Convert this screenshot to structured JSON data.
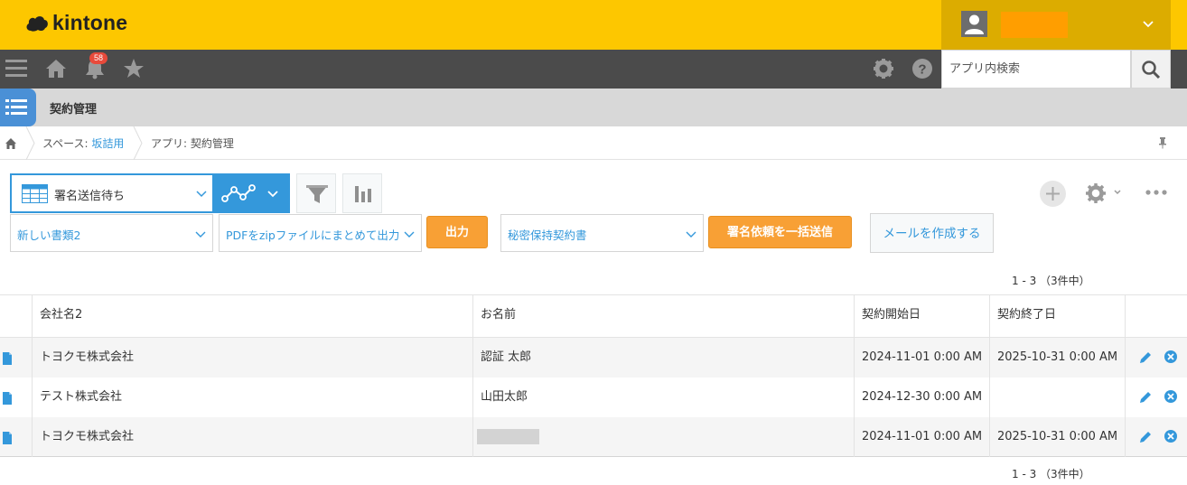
{
  "header": {
    "logo_text": "kintone",
    "user_name": ""
  },
  "nav": {
    "notification_count": "58",
    "search_placeholder": "アプリ内検索"
  },
  "app": {
    "title": "契約管理"
  },
  "breadcrumb": {
    "space_prefix": "スペース: ",
    "space_name": "坂詰用",
    "app_label": "アプリ: 契約管理"
  },
  "toolbar": {
    "view_name": "署名送信待ち",
    "dropdown_doc": "新しい書類2",
    "dropdown_pdf": "PDFをzipファイルにまとめて出力",
    "output_button": "出力",
    "dropdown_contract": "秘密保持契約書",
    "bulk_send_button": "署名依頼を一括送信",
    "mail_button": "メールを作成する"
  },
  "pager": {
    "top": "1 - 3 （3件中）",
    "bottom": "1 - 3 （3件中）"
  },
  "table": {
    "headers": [
      "会社名2",
      "お名前",
      "契約開始日",
      "契約終了日"
    ],
    "rows": [
      {
        "company": "トヨクモ株式会社",
        "name": "認証 太郎",
        "start": "2024-11-01 0:00 AM",
        "end": "2025-10-31 0:00 AM"
      },
      {
        "company": "テスト株式会社",
        "name": "山田太郎",
        "start": "2024-12-30 0:00 AM",
        "end": ""
      },
      {
        "company": "トヨクモ株式会社",
        "name": "",
        "start": "2024-11-01 0:00 AM",
        "end": "2025-10-31 0:00 AM"
      }
    ]
  },
  "colors": {
    "brand_yellow": "#fdc700",
    "accent_blue": "#3498db",
    "action_orange": "#f8a035",
    "nav_dark": "#4b4b4b"
  }
}
